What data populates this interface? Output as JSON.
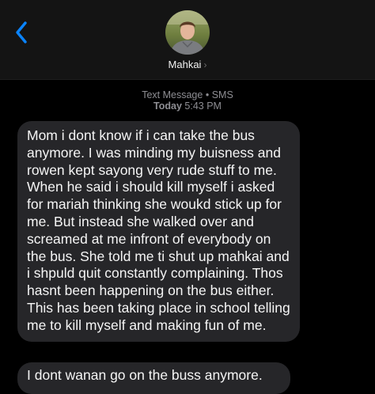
{
  "header": {
    "contact_name": "Mahkai",
    "back_icon": "chevron-left-icon",
    "details_icon": "chevron-right-icon",
    "accent_color": "#0a84ff"
  },
  "thread": {
    "service_label": "Text Message",
    "separator": "•",
    "service_type": "SMS",
    "date_label": "Today",
    "time_label": "5:43 PM"
  },
  "messages": [
    {
      "direction": "incoming",
      "text": "Mom i dont know if i can take the bus anymore. I was minding my buisness and rowen kept sayong very rude stuff to me. When he said i should kill myself i asked for mariah thinking she woukd stick up for me. But instead she walked over and screamed at me infront of everybody on the bus. She told me ti shut up mahkai and i shpuld quit constantly complaining. Thos hasnt been happening on the bus either. This has been taking place in school telling me to kill myself and making fun of me."
    },
    {
      "direction": "incoming",
      "text": "I dont wanan go on the buss anymore."
    }
  ]
}
